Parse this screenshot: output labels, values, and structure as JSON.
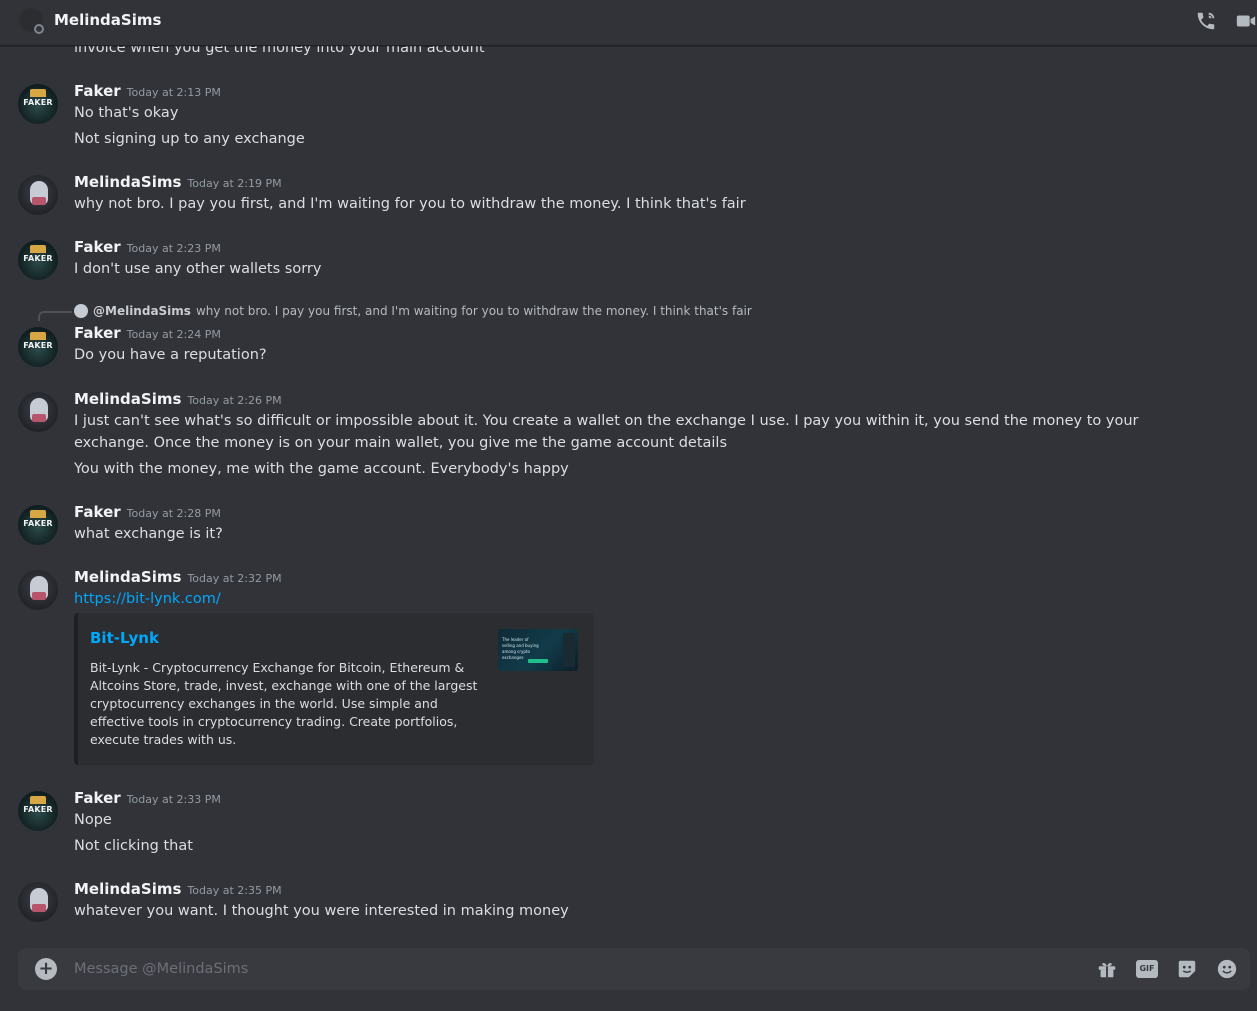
{
  "header": {
    "title": "MelindaSims"
  },
  "cutoff_line": "invoice when you get the money into your main account",
  "messages": [
    {
      "author": "Faker",
      "timestamp": "Today at 2:13 PM",
      "lines": [
        "No that's okay",
        "Not signing up to any exchange"
      ]
    },
    {
      "author": "MelindaSims",
      "timestamp": "Today at 2:19 PM",
      "lines": [
        "why not bro. I pay you first, and I'm waiting for you to withdraw the money. I think that's fair"
      ]
    },
    {
      "author": "Faker",
      "timestamp": "Today at 2:23 PM",
      "lines": [
        "I don't use any other wallets sorry"
      ]
    },
    {
      "author": "Faker",
      "timestamp": "Today at 2:24 PM",
      "reply": {
        "mention": "@MelindaSims",
        "text": "why not bro. I pay you first, and I'm waiting for you to withdraw the money. I think that's fair"
      },
      "lines": [
        "Do you have a reputation?"
      ]
    },
    {
      "author": "MelindaSims",
      "timestamp": "Today at 2:26 PM",
      "lines": [
        "I just can't see what's so difficult or impossible about it. You create a wallet on the exchange I use. I pay you within it, you send the money to your exchange. Once the money is on your main wallet, you give me the game account details",
        "You with the money, me with the game account. Everybody's happy"
      ]
    },
    {
      "author": "Faker",
      "timestamp": "Today at 2:28 PM",
      "lines": [
        "what exchange is it?"
      ]
    },
    {
      "author": "MelindaSims",
      "timestamp": "Today at 2:32 PM",
      "link": "https://bit-lynk.com/",
      "embed": {
        "title": "Bit-Lynk",
        "description": "Bit-Lynk - Cryptocurrency Exchange for Bitcoin, Ethereum & Altcoins Store, trade, invest, exchange with one of the largest cryptocurrency exchanges in the world. Use simple and effective tools in cryptocurrency trading. Create portfolios, execute trades with us.",
        "thumbnail_text": "The leader of selling and buying among crypto exchanges"
      }
    },
    {
      "author": "Faker",
      "timestamp": "Today at 2:33 PM",
      "lines": [
        "Nope",
        "Not clicking that"
      ]
    },
    {
      "author": "MelindaSims",
      "timestamp": "Today at 2:35 PM",
      "lines": [
        "whatever you want. I thought you were interested in making money"
      ]
    }
  ],
  "composer": {
    "placeholder": "Message @MelindaSims",
    "gif_label": "GIF"
  },
  "avatar_labels": {
    "faker": "FAKER"
  },
  "icons": {
    "header": [
      "phone-call-icon",
      "video-camera-icon"
    ],
    "composer": [
      "add-attachment-icon",
      "gift-icon",
      "gif-icon",
      "sticker-icon",
      "emoji-icon"
    ]
  },
  "colors": {
    "background": "#313338",
    "link": "#00a8fc",
    "composer": "#383a40"
  }
}
